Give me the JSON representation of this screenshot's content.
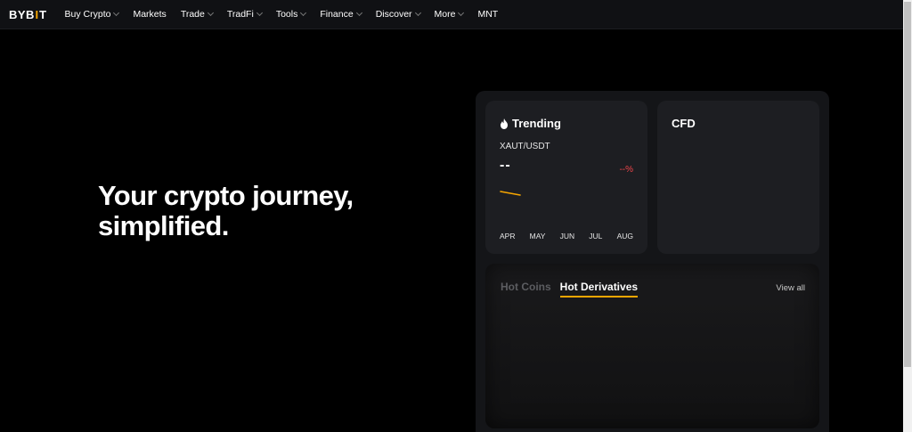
{
  "header": {
    "logo_left": "BYB",
    "logo_mid": "I",
    "logo_right": "T",
    "nav": [
      {
        "label": "Buy Crypto",
        "dropdown": true
      },
      {
        "label": "Markets",
        "dropdown": false
      },
      {
        "label": "Trade",
        "dropdown": true
      },
      {
        "label": "TradFi",
        "dropdown": true
      },
      {
        "label": "Tools",
        "dropdown": true
      },
      {
        "label": "Finance",
        "dropdown": true
      },
      {
        "label": "Discover",
        "dropdown": true
      },
      {
        "label": "More",
        "dropdown": true
      },
      {
        "label": "MNT",
        "dropdown": false
      }
    ]
  },
  "hero": {
    "line1": "Your crypto journey,",
    "line2": "simplified."
  },
  "trending": {
    "title": "Trending",
    "icon": "fire-icon",
    "pair": "XAUT/USDT",
    "price": "--",
    "change": "--%",
    "months": [
      "APR",
      "MAY",
      "JUN",
      "JUL",
      "AUG"
    ]
  },
  "cfd": {
    "title": "CFD"
  },
  "hot": {
    "tabs": [
      "Hot Coins",
      "Hot Derivatives"
    ],
    "active_tab": 1,
    "view_all": "View all"
  },
  "colors": {
    "accent": "#f7a600",
    "negative": "#ef454a",
    "background": "#000000",
    "card": "#1d1e22"
  }
}
